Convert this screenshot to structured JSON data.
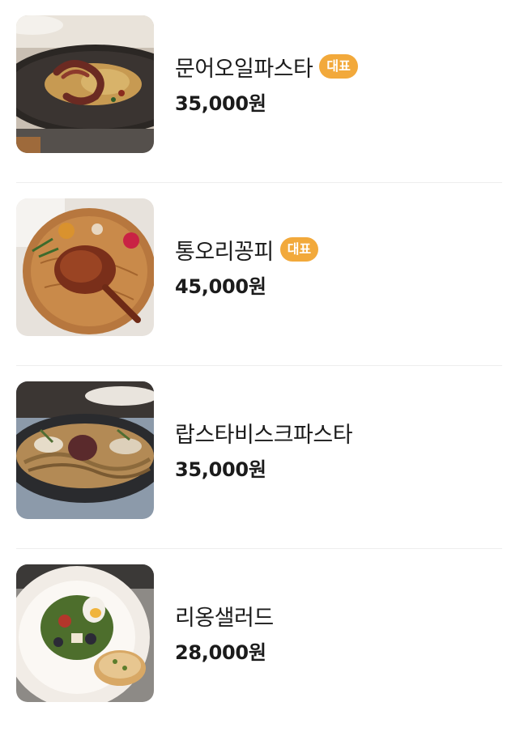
{
  "colors": {
    "badge_bg": "#f2a93b",
    "divider": "#eeeeee",
    "text": "#1b1b1b"
  },
  "menu": {
    "items": [
      {
        "name": "문어오일파스타",
        "badge": "대표",
        "price": "35,000원",
        "image": "octopus-oil-pasta-photo"
      },
      {
        "name": "통오리꽁피",
        "badge": "대표",
        "price": "45,000원",
        "image": "whole-duck-confit-photo"
      },
      {
        "name": "랍스타비스크파스타",
        "badge": "",
        "price": "35,000원",
        "image": "lobster-bisque-pasta-photo"
      },
      {
        "name": "리옹샐러드",
        "badge": "",
        "price": "28,000원",
        "image": "lyon-salad-photo"
      }
    ]
  }
}
